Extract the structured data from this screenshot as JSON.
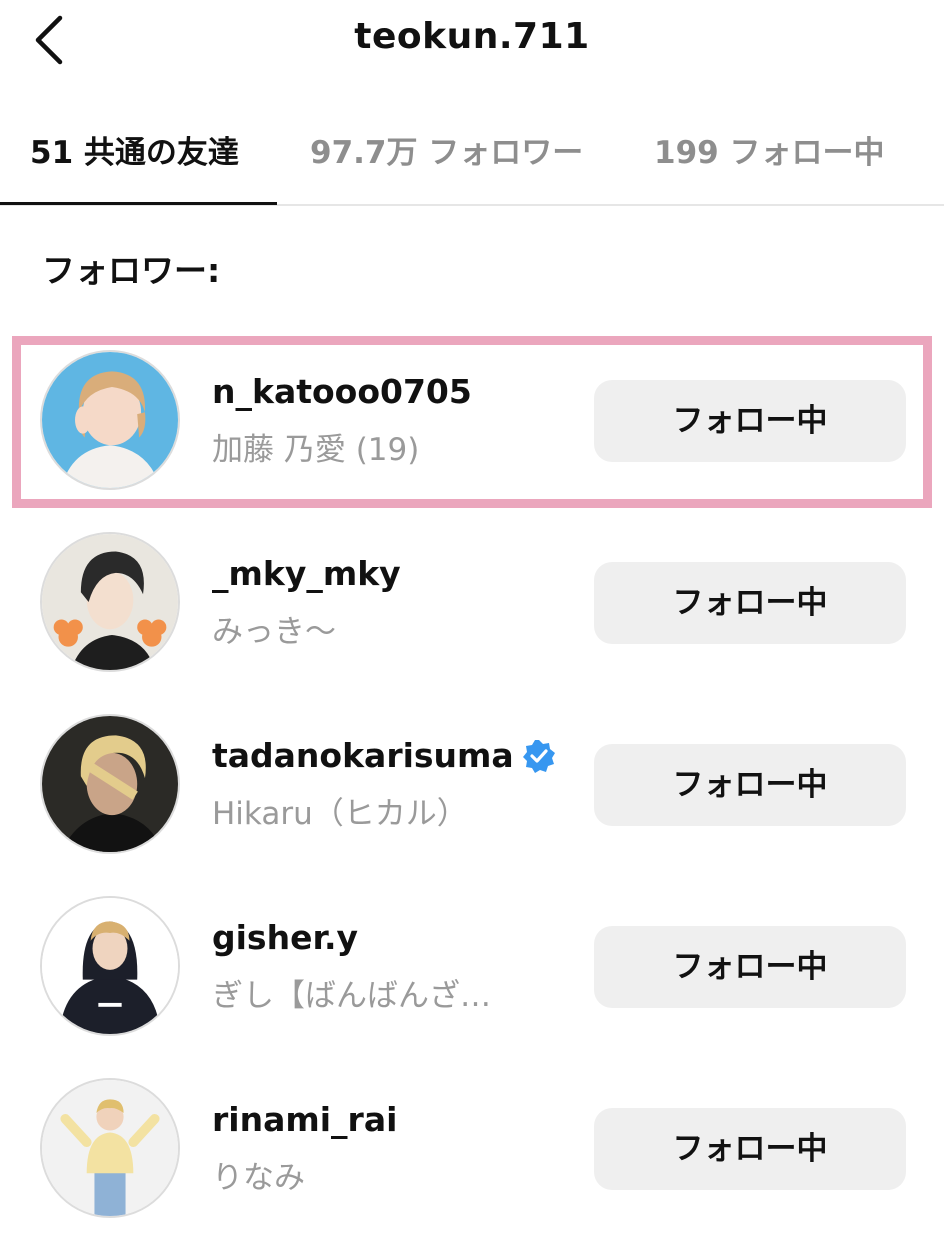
{
  "header": {
    "back_icon": "chevron-left-icon",
    "title": "teokun.711"
  },
  "tabs": [
    {
      "label": "51 共通の友達",
      "active": true
    },
    {
      "label": "97.7万 フォロワー",
      "active": false
    },
    {
      "label": "199 フォロー中",
      "active": false
    }
  ],
  "section": {
    "title": "フォロワー:"
  },
  "users": [
    {
      "username": "n_katooo0705",
      "fullname": "加藤 乃愛 (19)",
      "button": "フォロー中",
      "verified": false,
      "highlighted": true
    },
    {
      "username": "_mky_mky",
      "fullname": "みっき〜",
      "button": "フォロー中",
      "verified": false,
      "highlighted": false
    },
    {
      "username": "tadanokarisuma",
      "fullname": "Hikaru（ヒカル）",
      "button": "フォロー中",
      "verified": true,
      "highlighted": false
    },
    {
      "username": "gisher.y",
      "fullname": "ぎし【ばんばんざ…",
      "button": "フォロー中",
      "verified": false,
      "highlighted": false
    },
    {
      "username": "rinami_rai",
      "fullname": "りなみ",
      "button": "フォロー中",
      "verified": false,
      "highlighted": false
    }
  ],
  "colors": {
    "highlight_border": "#eba6bd",
    "verified_blue": "#3797f0",
    "button_bg": "#efefef",
    "secondary_text": "#9a9a9a"
  }
}
